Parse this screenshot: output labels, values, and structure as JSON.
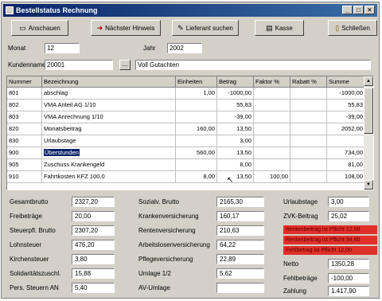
{
  "window": {
    "title": "Bestellstatus Rechnung",
    "controls": [
      "_",
      "□",
      "×"
    ]
  },
  "toolbar": {
    "buttons": [
      {
        "label": "Anschauen",
        "icon": "▭"
      },
      {
        "label": "Nächster Hinweis",
        "icon": "➜"
      },
      {
        "label": "Lieferant suchen",
        "icon": "✎"
      },
      {
        "label": "Kasse",
        "icon": "▤"
      },
      {
        "label": "Schließen",
        "icon": "▯"
      }
    ]
  },
  "header": {
    "monat_label": "Monat",
    "monat_value": "12",
    "jahr_label": "Jahr",
    "jahr_value": "2002",
    "kunde_label": "Kundenname",
    "kunde_value": "20001",
    "kunde_name": "Voll Gutachten",
    "dots_label": "..."
  },
  "table": {
    "columns": [
      "Nummer",
      "Bezeichnung",
      "Einheiten",
      "Betrag",
      "Faktor %",
      "Rabatt %",
      "Summe"
    ],
    "rows": [
      [
        "801",
        "abschlag",
        "1,00",
        "-1000,00",
        "",
        "",
        "-1000,00"
      ],
      [
        "802",
        "VMA Anteil AG 1/10",
        "",
        "55,83",
        "",
        "",
        "55,83"
      ],
      [
        "803",
        "VMA Anrechnung 1/10",
        "",
        "-39,00",
        "",
        "",
        "-39,00"
      ],
      [
        "820",
        "Monatsbeitrag",
        "160,00",
        "13,50",
        "",
        "",
        "2052,00"
      ],
      [
        "830",
        "Urlaubstage",
        "",
        "3,00",
        "",
        "",
        ""
      ],
      [
        "900",
        "Überstunden",
        "560,00",
        "13,50",
        "",
        "",
        "734,00"
      ],
      [
        "905",
        "Zuschuss Krankengeld",
        "",
        "8,00",
        "",
        "",
        "81,00"
      ],
      [
        "910",
        "Fahrtkosten KFZ 100,0",
        "8,00",
        "13,50",
        "100,00",
        "",
        "108,00"
      ]
    ],
    "selected_row": 5
  },
  "summary": {
    "col1": [
      {
        "label": "Gesamtbrutto",
        "value": "2327,20"
      },
      {
        "label": "Freibeträge",
        "value": "20,00"
      },
      {
        "label": "Steuerpfl. Brutto",
        "value": "2307,20"
      },
      {
        "label": "Lohnsteuer",
        "value": "476,20"
      },
      {
        "label": "Kirchensteuer",
        "value": "3,80"
      },
      {
        "label": "Solidaritätszuschl.",
        "value": "15,88"
      },
      {
        "label": "Pers. Steuern AN",
        "value": "5,40"
      }
    ],
    "col2": [
      {
        "label": "Sozialv. Brutto",
        "value": "2165,30"
      },
      {
        "label": "Krankenversicherung",
        "value": "160,17"
      },
      {
        "label": "Rentenversicherung",
        "value": "210,63"
      },
      {
        "label": "Arbeitslosenversicherung",
        "value": "64,22"
      },
      {
        "label": "Pflegeversicherung",
        "value": "22,89"
      },
      {
        "label": "Umlage 1/2",
        "value": "5,62"
      },
      {
        "label": "AV-Umlage",
        "value": ""
      }
    ],
    "col3": {
      "urlaubstage_label": "Urlaubstage",
      "urlaubstage_value": "3,00",
      "zvk_label": "ZVK-Beitrag",
      "zvk_value": "25,02",
      "red_alerts": [
        "Rentenbeitrag ist Pflicht 12,00",
        "Rentenbeitrag ist Pflicht 34,60",
        "Fehlbetrag ist Pflicht 12,00"
      ],
      "netto_label": "Netto",
      "netto_value": "1350,28",
      "fehlbetrag_label": "Fehlbeträge",
      "fehlbetrag_value": "-100,00",
      "zahlung_label": "Zahlung",
      "zahlung_value": "1.417,90"
    }
  },
  "colors": {
    "titlebar": "#0a246a",
    "window_bg": "#d4d0c8",
    "alert": "#e0302a"
  }
}
